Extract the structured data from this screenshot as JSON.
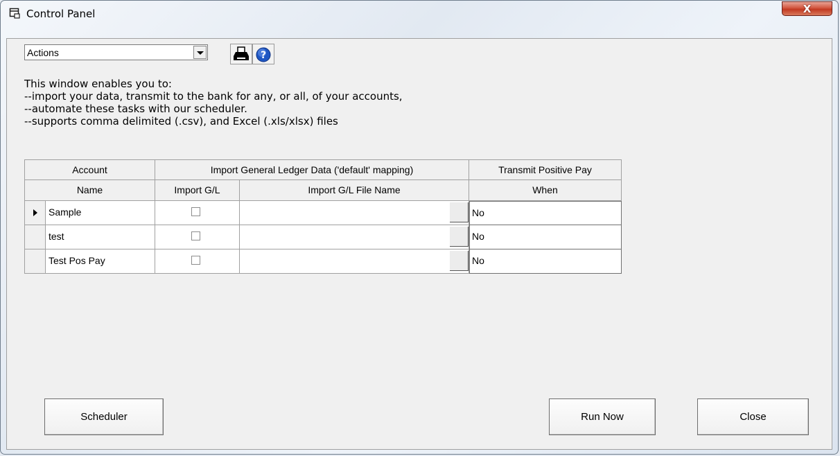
{
  "window": {
    "title": "Control Panel",
    "close_label": "X",
    "icon": "window-app-icon"
  },
  "toolbar": {
    "actions_value": "Actions",
    "print_icon": "printer-icon",
    "help_icon": "help-icon"
  },
  "description": {
    "line1": "This window enables you to:",
    "line2": "--import your data, transmit to the bank for any, or all, of your accounts,",
    "line3": "--automate these tasks with our scheduler.",
    "line4": "--supports comma delimited (.csv), and Excel (.xls/xlsx) files"
  },
  "grid": {
    "group_headers": [
      "Account",
      "Import General Ledger Data ('default' mapping)",
      "Transmit Positive Pay"
    ],
    "column_headers": [
      "Name",
      "Import G/L",
      "Import G/L File Name",
      "When"
    ],
    "rows": [
      {
        "name": "Sample",
        "import_gl": false,
        "file": "",
        "when": "No",
        "current": true
      },
      {
        "name": "test",
        "import_gl": false,
        "file": "",
        "when": "No",
        "current": false
      },
      {
        "name": "Test Pos Pay",
        "import_gl": false,
        "file": "",
        "when": "No",
        "current": false
      }
    ]
  },
  "buttons": {
    "scheduler": "Scheduler",
    "run_now": "Run Now",
    "close": "Close"
  }
}
